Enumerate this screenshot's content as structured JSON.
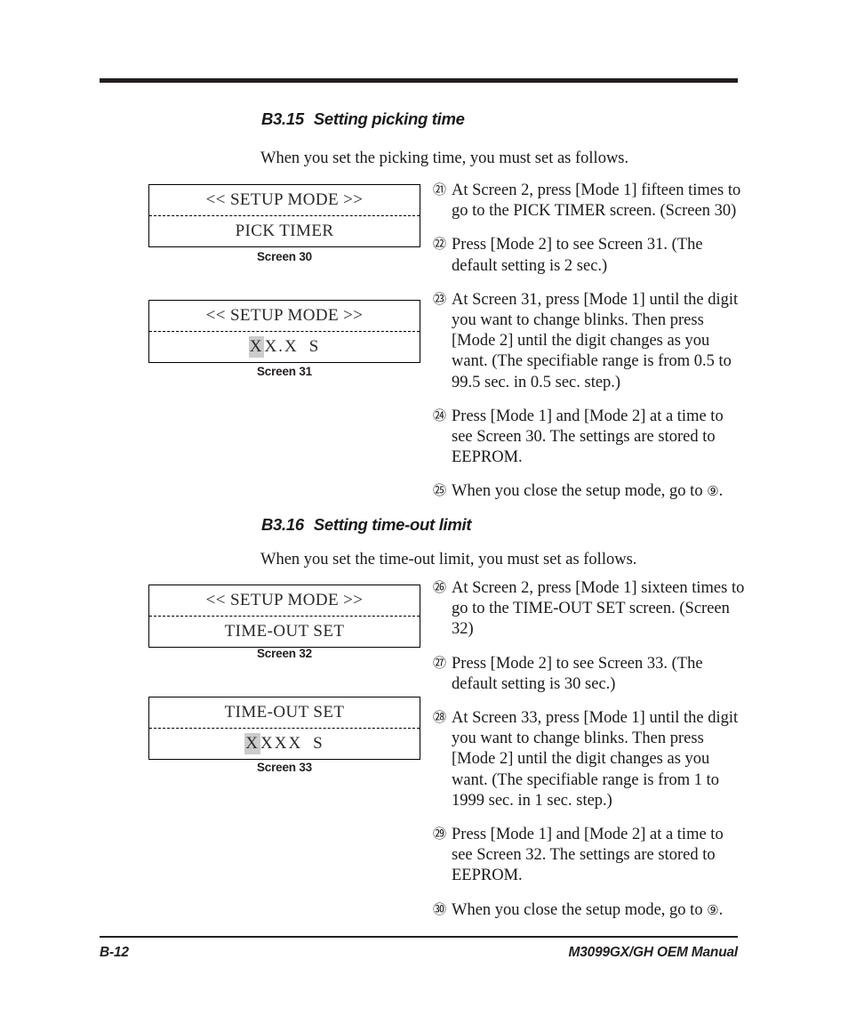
{
  "footer": {
    "page_number": "B-12",
    "manual_title": "M3099GX/GH OEM Manual"
  },
  "sections": [
    {
      "number": "B3.15",
      "title": "Setting picking time",
      "intro": "When you set the picking time, you must set as follows.",
      "screens": [
        {
          "caption": "Screen 30",
          "line1": "<< SETUP MODE >>",
          "line2": "PICK TIMER",
          "line2_kind": "text"
        },
        {
          "caption": "Screen 31",
          "line1": "<< SETUP MODE >>",
          "line2_kind": "digits",
          "digits": [
            "X",
            "X",
            ".",
            "X"
          ],
          "digits_highlight_index": 0,
          "digits_unit": "S"
        }
      ],
      "steps": [
        {
          "marker": "㉑",
          "text": "At Screen 2, press [Mode 1] fifteen times to go to the PICK TIMER screen. (Screen 30)"
        },
        {
          "marker": "㉒",
          "text": "Press [Mode 2] to see Screen 31. (The default setting is 2 sec.)"
        },
        {
          "marker": "㉓",
          "text": "At Screen 31, press [Mode 1] until the digit you want to change blinks. Then press [Mode 2] until the digit changes as you want. (The specifiable range is from 0.5 to 99.5 sec. in 0.5 sec. step.)"
        },
        {
          "marker": "㉔",
          "text": "Press [Mode 1] and [Mode 2] at a time to see Screen 30. The settings are stored to EEPROM."
        },
        {
          "marker": "㉕",
          "text_before": "When you close the setup mode, go to ",
          "inline_circled": "⑨",
          "text_after": "."
        }
      ]
    },
    {
      "number": "B3.16",
      "title": "Setting time-out limit",
      "intro": "When you set the time-out limit, you must set as follows.",
      "screens": [
        {
          "caption": "Screen 32",
          "line1": "<< SETUP MODE >>",
          "line2": "TIME-OUT SET",
          "line2_kind": "text"
        },
        {
          "caption": "Screen 33",
          "line1": "TIME-OUT SET",
          "line2_kind": "digits",
          "digits": [
            "X",
            "X",
            "X",
            "X"
          ],
          "digits_highlight_index": 0,
          "digits_unit": "S"
        }
      ],
      "steps": [
        {
          "marker": "㉖",
          "text": "At Screen 2, press [Mode 1] sixteen times to go to the TIME-OUT SET screen. (Screen 32)"
        },
        {
          "marker": "㉗",
          "text": "Press [Mode 2] to see Screen 33. (The default setting is 30 sec.)"
        },
        {
          "marker": "㉘",
          "text": "At Screen 33, press [Mode 1] until the digit you want to change blinks. Then press [Mode 2] until the digit changes as you want. (The specifiable range is from 1 to 1999 sec. in 1 sec. step.)"
        },
        {
          "marker": "㉙",
          "text": "Press [Mode 1] and [Mode 2] at a time to see Screen 32. The settings are stored to EEPROM."
        },
        {
          "marker": "㉚",
          "text_before": "When you close the setup mode, go to ",
          "inline_circled": "⑨",
          "text_after": "."
        }
      ]
    }
  ]
}
